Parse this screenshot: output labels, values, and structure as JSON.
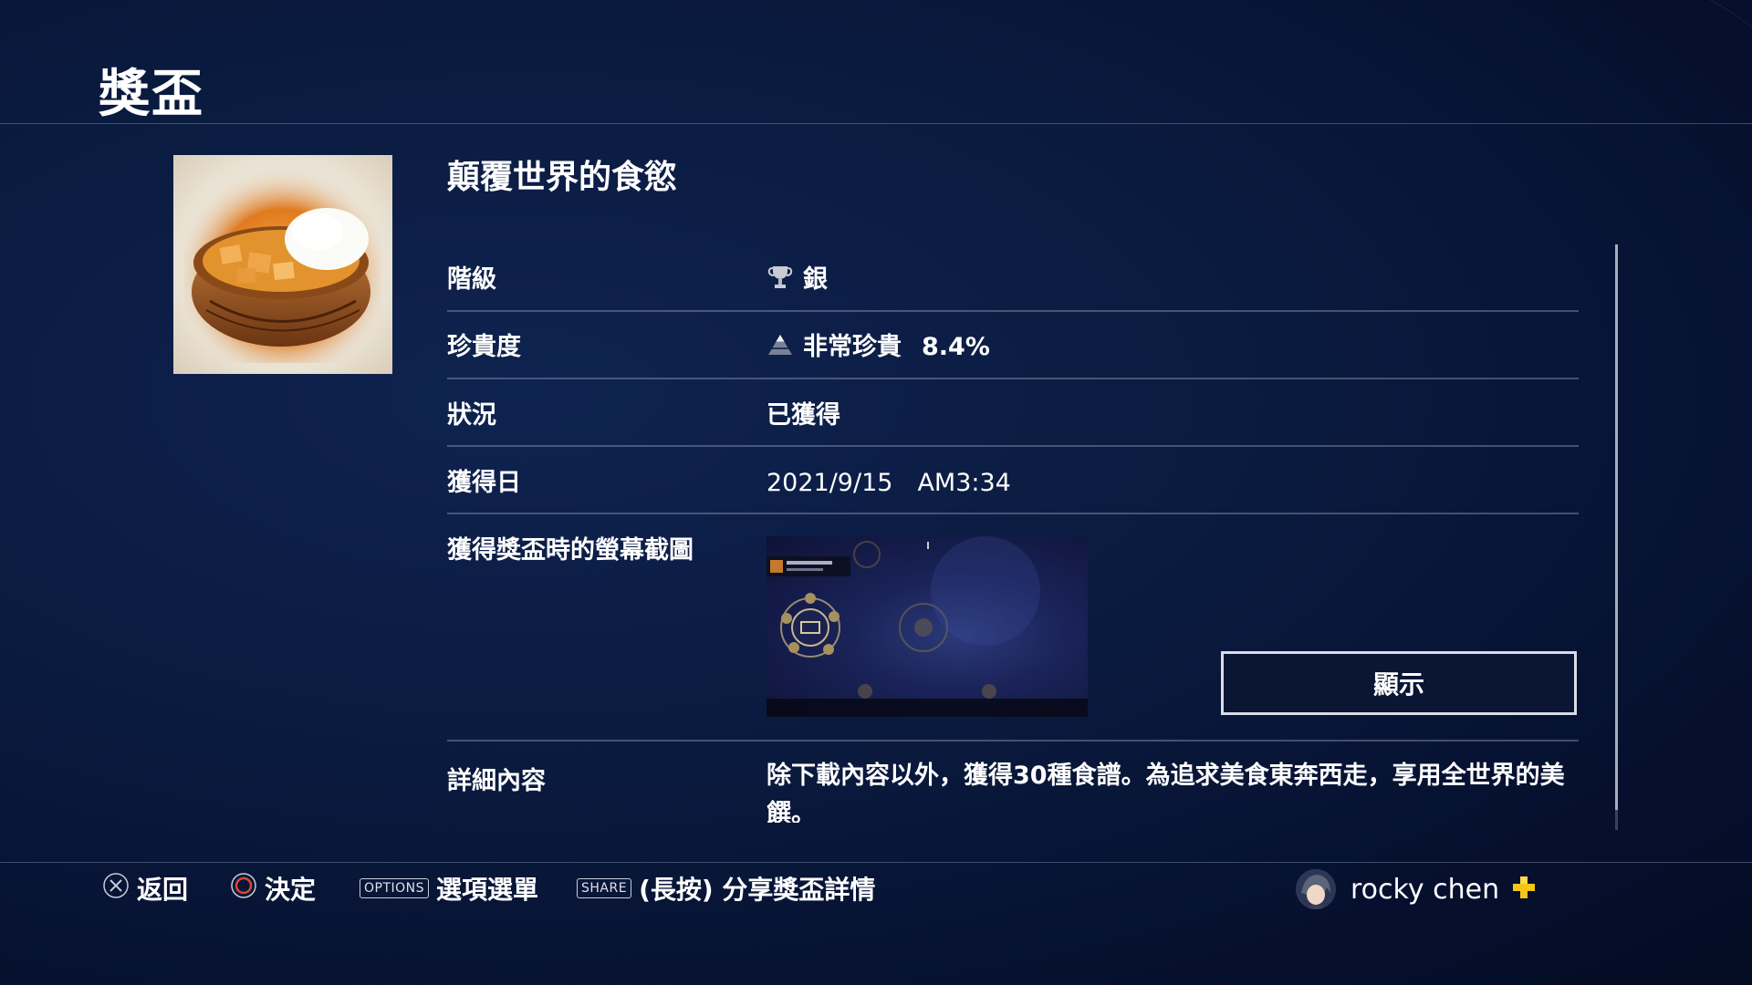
{
  "header": {
    "title": "獎盃"
  },
  "trophy": {
    "name": "顛覆世界的食慾",
    "fields": {
      "grade_label": "階級",
      "grade_value": "銀",
      "rarity_label": "珍貴度",
      "rarity_value": "非常珍貴",
      "rarity_percent": "8.4%",
      "status_label": "狀況",
      "status_value": "已獲得",
      "date_label": "獲得日",
      "date_value": "2021/9/15　AM3:34",
      "screenshot_label": "獲得獎盃時的螢幕截圖",
      "detail_label": "詳細內容",
      "detail_value": "除下載內容以外，獲得30種食譜。為追求美食東奔西走，享用全世界的美饌。"
    },
    "show_button": "顯示"
  },
  "footer": {
    "back": "返回",
    "confirm": "決定",
    "options_key": "OPTIONS",
    "options": "選項選單",
    "share_key": "SHARE",
    "share": "(長按) 分享獎盃詳情"
  },
  "user": {
    "name": "rocky chen"
  },
  "colors": {
    "background": "#0a1a3e",
    "plus": "#f5c518",
    "divider": "#5a6585"
  },
  "icons": {
    "grade": "silver-trophy-icon",
    "rarity": "rarity-pyramid-icon",
    "cross": "cross-button-icon",
    "circle": "circle-button-icon",
    "plus": "ps-plus-icon"
  }
}
